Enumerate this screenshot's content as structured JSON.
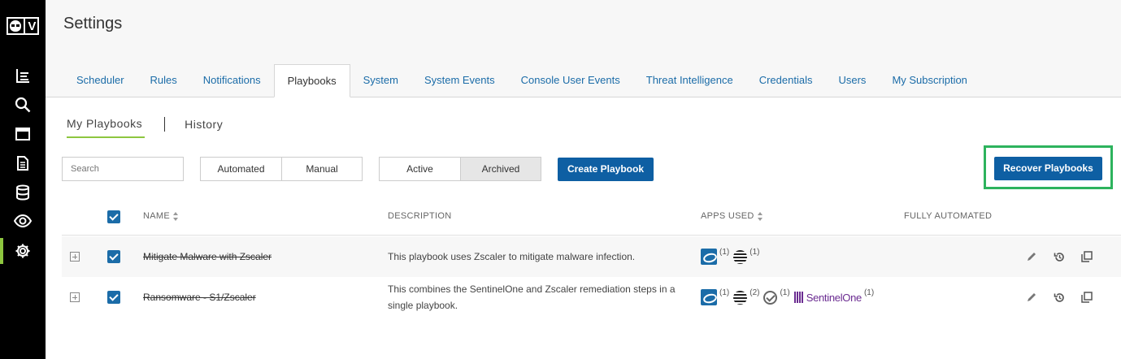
{
  "app": {
    "logo_letter": "V"
  },
  "header": {
    "title": "Settings"
  },
  "tabs": [
    {
      "label": "Scheduler"
    },
    {
      "label": "Rules"
    },
    {
      "label": "Notifications"
    },
    {
      "label": "Playbooks"
    },
    {
      "label": "System"
    },
    {
      "label": "System Events"
    },
    {
      "label": "Console User Events"
    },
    {
      "label": "Threat Intelligence"
    },
    {
      "label": "Credentials"
    },
    {
      "label": "Users"
    },
    {
      "label": "My Subscription"
    }
  ],
  "active_tab": "Playbooks",
  "subtabs": {
    "my_playbooks": "My Playbooks",
    "history": "History"
  },
  "toolbar": {
    "search_placeholder": "Search",
    "automated": "Automated",
    "manual": "Manual",
    "active": "Active",
    "archived": "Archived",
    "create": "Create Playbook",
    "recover": "Recover Playbooks"
  },
  "table": {
    "headers": {
      "name": "NAME",
      "description": "DESCRIPTION",
      "apps": "APPS USED",
      "fully_automated": "FULLY AUTOMATED"
    },
    "rows": [
      {
        "name": "Mitigate Malware with Zscaler",
        "description": "This playbook uses Zscaler to mitigate malware infection.",
        "zscaler_count": "(1)",
        "att_count": "(1)"
      },
      {
        "name": "Ransomware - S1/Zscaler",
        "description": "This combines the SentinelOne and Zscaler remediation steps in a single playbook.",
        "zscaler_count": "(1)",
        "att_count": "(2)",
        "check_count": "(1)",
        "sentinelone_label": "SentinelOne",
        "sentinelone_count": "(1)"
      }
    ]
  },
  "colors": {
    "accent": "#8dc63f",
    "primary": "#0e5fa3",
    "link": "#1b6ca8",
    "highlight": "#2db35d",
    "sentinelone": "#6b2c91"
  },
  "icons": [
    "logo-icon",
    "reports-icon",
    "search-icon",
    "browser-icon",
    "document-icon",
    "database-icon",
    "eye-icon",
    "gear-icon",
    "sort-icon",
    "expand-icon",
    "edit-icon",
    "restore-icon",
    "copy-icon"
  ]
}
